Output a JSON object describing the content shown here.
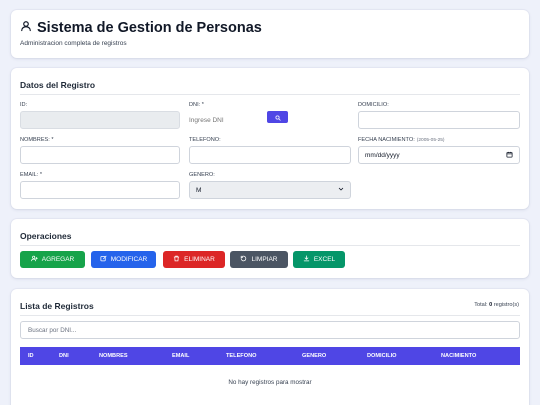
{
  "header": {
    "title": "Sistema de Gestion de Personas",
    "subtitle": "Administracion completa de registros"
  },
  "datos": {
    "title": "Datos del Registro",
    "id_label": "ID:",
    "dni_label": "DNI: *",
    "dni_placeholder": "Ingrese DNI",
    "domicilio_label": "DOMICILIO:",
    "nombres_label": "NOMBRES: *",
    "telefono_label": "TELEFONO:",
    "fecha_label": "FECHA NACIMIENTO:",
    "fecha_hint": "(2005-05-25)",
    "fecha_value": "mm/dd/yyyy",
    "email_label": "EMAIL: *",
    "genero_label": "GENERO:",
    "genero_value": "M"
  },
  "operaciones": {
    "title": "Operaciones",
    "agregar": "AGREGAR",
    "modificar": "MODIFICAR",
    "eliminar": "ELIMINAR",
    "limpiar": "LIMPIAR",
    "excel": "EXCEL"
  },
  "lista": {
    "title": "Lista de Registros",
    "total_prefix": "Total:",
    "total_count": "0",
    "total_suffix": "registro(s)",
    "search_placeholder": "Buscar por DNI...",
    "columns": [
      "ID",
      "DNI",
      "NOMBRES",
      "EMAIL",
      "TELEFONO",
      "GENERO",
      "DOMICILIO",
      "NACIMIENTO"
    ],
    "empty_message": "No hay registros para mostrar"
  },
  "colors": {
    "accent": "#4f46e5",
    "agregar": "#16a34a",
    "modificar": "#2563eb",
    "eliminar": "#dc2626",
    "limpiar": "#4b5563",
    "excel": "#059669"
  },
  "icons": {
    "header": "user-icon",
    "dni_search": "search-icon",
    "agregar": "user-plus-icon",
    "modificar": "edit-icon",
    "eliminar": "trash-icon",
    "limpiar": "refresh-icon",
    "excel": "download-icon",
    "fecha": "calendar-icon",
    "genero": "chevron-down-icon"
  }
}
